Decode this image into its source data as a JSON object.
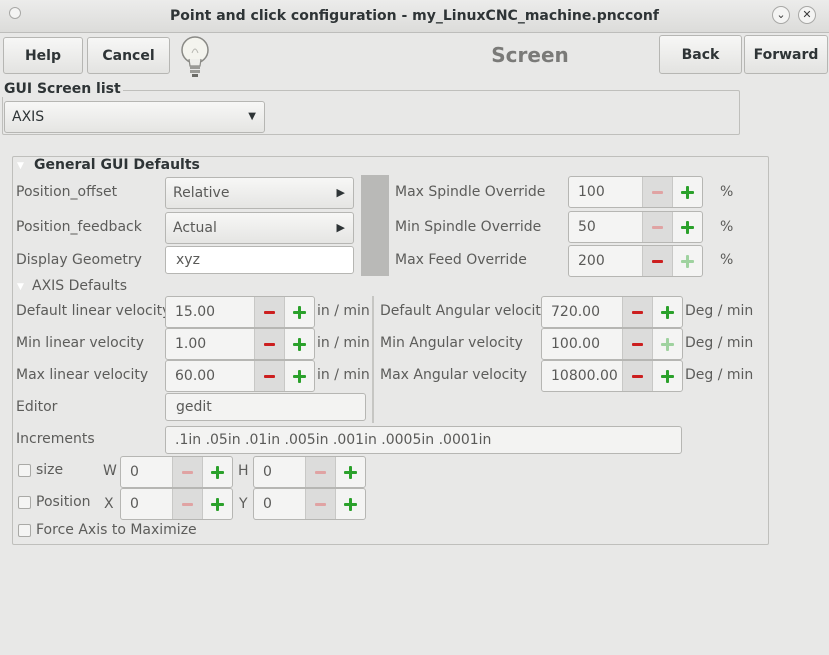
{
  "window": {
    "title": "Point and click configuration - my_LinuxCNC_machine.pncconf"
  },
  "toolbar": {
    "help": "Help",
    "cancel": "Cancel",
    "back": "Back",
    "forward": "Forward",
    "page_title": "Screen"
  },
  "gui_screen_list": {
    "label": "GUI Screen list",
    "selected": "AXIS"
  },
  "general": {
    "label": "General GUI Defaults",
    "position_offset": {
      "label": "Position_offset",
      "value": "Relative"
    },
    "position_feedback": {
      "label": "Position_feedback",
      "value": "Actual"
    },
    "display_geometry": {
      "label": "Display Geometry",
      "value": "xyz"
    },
    "max_spindle_override": {
      "label": "Max Spindle Override",
      "value": "100",
      "unit": "%"
    },
    "min_spindle_override": {
      "label": "Min Spindle Override",
      "value": "50",
      "unit": "%"
    },
    "max_feed_override": {
      "label": "Max Feed Override",
      "value": "200",
      "unit": "%"
    }
  },
  "axis": {
    "label": "AXIS Defaults",
    "default_linear_velocity": {
      "label": "Default linear velocity",
      "value": "15.00",
      "unit": "in / min"
    },
    "min_linear_velocity": {
      "label": "Min linear velocity",
      "value": "1.00",
      "unit": "in / min"
    },
    "max_linear_velocity": {
      "label": "Max linear velocity",
      "value": "60.00",
      "unit": "in / min"
    },
    "default_angular_velocity": {
      "label": "Default Angular velocity",
      "value": "720.00",
      "unit": "Deg / min"
    },
    "min_angular_velocity": {
      "label": "Min Angular velocity",
      "value": "100.00",
      "unit": "Deg / min"
    },
    "max_angular_velocity": {
      "label": "Max Angular velocity",
      "value": "10800.00",
      "unit": "Deg / min"
    },
    "editor": {
      "label": "Editor",
      "value": "gedit"
    },
    "increments": {
      "label": "Increments",
      "value": ".1in .05in .01in .005in .001in .0005in .0001in"
    },
    "size": {
      "label": "size",
      "w_label": "W",
      "w_value": "0",
      "h_label": "H",
      "h_value": "0",
      "checked": false
    },
    "position": {
      "label": "Position",
      "x_label": "X",
      "x_value": "0",
      "y_label": "Y",
      "y_value": "0",
      "checked": false
    },
    "force_maximize": {
      "label": "Force Axis to Maximize",
      "checked": false
    }
  }
}
